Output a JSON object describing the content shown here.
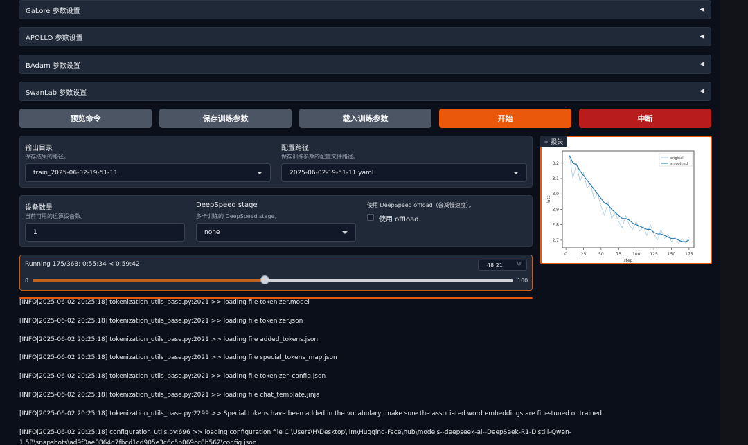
{
  "accordions": [
    {
      "label": "GaLore 参数设置"
    },
    {
      "label": "APOLLO 参数设置"
    },
    {
      "label": "BAdam 参数设置"
    },
    {
      "label": "SwanLab 参数设置"
    }
  ],
  "accordion_arrow": "◀",
  "buttons": {
    "preview": "预览命令",
    "save": "保存训练参数",
    "load": "载入训练参数",
    "start": "开始",
    "abort": "中断"
  },
  "colors": {
    "start": "#ea580c",
    "abort": "#b91c1c",
    "progress": "#c2611a",
    "series_original": "#a9cce3",
    "series_smoothed": "#1f77b4"
  },
  "output_dir": {
    "label": "输出目录",
    "info": "保存结果的路径。",
    "value": "train_2025-06-02-19-51-11"
  },
  "config_path": {
    "label": "配置路径",
    "info": "保存训练参数的配置文件路径。",
    "value": "2025-06-02-19-51-11.yaml"
  },
  "device_count": {
    "label": "设备数量",
    "info": "当前可用的运算设备数。",
    "value": "1"
  },
  "ds_stage": {
    "label": "DeepSpeed stage",
    "info": "多卡训练的 DeepSpeed stage。",
    "value": "none"
  },
  "ds_offload": {
    "label": "使用 DeepSpeed offload（会减慢速度）。",
    "checkbox_label": "使用 offload",
    "checked": false
  },
  "progress": {
    "label": "Running 175/363: 0:55:34 < 0:59:42",
    "value": "48.21",
    "fraction": 0.4821,
    "min": "0",
    "max": "100",
    "reset_icon": "↺"
  },
  "plot": {
    "label": "损失",
    "icon": "chart-icon"
  },
  "chart_data": {
    "type": "line",
    "xlabel": "step",
    "ylabel": "loss",
    "xlim": [
      -5,
      182
    ],
    "ylim": [
      2.65,
      3.28
    ],
    "xticks": [
      0,
      25,
      50,
      75,
      100,
      125,
      150,
      175
    ],
    "yticks": [
      2.7,
      2.8,
      2.9,
      3.0,
      3.1,
      3.2
    ],
    "legend_position": "top-right",
    "series": [
      {
        "name": "original",
        "x": [
          5,
          10,
          15,
          20,
          25,
          30,
          35,
          40,
          45,
          50,
          55,
          60,
          65,
          70,
          75,
          80,
          85,
          90,
          95,
          100,
          105,
          110,
          115,
          120,
          125,
          130,
          135,
          140,
          145,
          150,
          155,
          160,
          165,
          170,
          175
        ],
        "y": [
          3.25,
          3.1,
          3.2,
          3.08,
          3.14,
          3.04,
          3.06,
          2.97,
          3.0,
          2.92,
          2.86,
          2.95,
          2.84,
          2.88,
          2.82,
          2.78,
          2.86,
          2.8,
          2.77,
          2.82,
          2.76,
          2.79,
          2.73,
          2.8,
          2.74,
          2.7,
          2.77,
          2.71,
          2.74,
          2.69,
          2.72,
          2.68,
          2.71,
          2.68,
          2.72
        ]
      },
      {
        "name": "smoothed",
        "x": [
          5,
          10,
          15,
          20,
          25,
          30,
          35,
          40,
          45,
          50,
          55,
          60,
          65,
          70,
          75,
          80,
          85,
          90,
          95,
          100,
          105,
          110,
          115,
          120,
          125,
          130,
          135,
          140,
          145,
          150,
          155,
          160,
          165,
          170,
          175
        ],
        "y": [
          3.25,
          3.2,
          3.19,
          3.15,
          3.12,
          3.09,
          3.06,
          3.03,
          3.0,
          2.97,
          2.94,
          2.93,
          2.9,
          2.88,
          2.86,
          2.84,
          2.84,
          2.83,
          2.81,
          2.8,
          2.79,
          2.78,
          2.77,
          2.77,
          2.75,
          2.74,
          2.74,
          2.73,
          2.72,
          2.71,
          2.71,
          2.7,
          2.69,
          2.69,
          2.7
        ]
      }
    ]
  },
  "log_lines": [
    "[INFO|2025-06-02 20:25:18] tokenization_utils_base.py:2021 >> loading file tokenizer.model",
    "[INFO|2025-06-02 20:25:18] tokenization_utils_base.py:2021 >> loading file tokenizer.json",
    "[INFO|2025-06-02 20:25:18] tokenization_utils_base.py:2021 >> loading file added_tokens.json",
    "[INFO|2025-06-02 20:25:18] tokenization_utils_base.py:2021 >> loading file special_tokens_map.json",
    "[INFO|2025-06-02 20:25:18] tokenization_utils_base.py:2021 >> loading file tokenizer_config.json",
    "[INFO|2025-06-02 20:25:18] tokenization_utils_base.py:2021 >> loading file chat_template.jinja",
    "[INFO|2025-06-02 20:25:18] tokenization_utils_base.py:2299 >> Special tokens have been added in the vocabulary, make sure the associated word embeddings are fine-tuned or trained.",
    "[INFO|2025-06-02 20:25:18] configuration_utils.py:696 >> loading configuration file C:\\Users\\H\\Desktop\\llm\\Hugging-Face\\hub\\models--deepseek-ai--DeepSeek-R1-Distill-Qwen-",
    "1.5B\\snapshots\\ad9f0ae0864d7fbcd1cd905e3c6c5b069cc8b562\\config.json"
  ]
}
